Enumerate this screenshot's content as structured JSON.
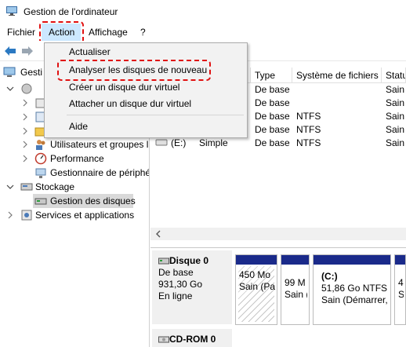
{
  "window": {
    "title": "Gestion de l'ordinateur",
    "icon": "computer-management-icon"
  },
  "menubar": {
    "items": [
      {
        "label": "Fichier"
      },
      {
        "label": "Action"
      },
      {
        "label": "Affichage"
      },
      {
        "label": "?"
      }
    ]
  },
  "action_menu": {
    "items": [
      {
        "label": "Actualiser"
      },
      {
        "label": "Analyser les disques de nouveau"
      },
      {
        "label": "Créer un disque dur virtuel"
      },
      {
        "label": "Attacher un disque dur virtuel"
      },
      {
        "label": "Aide"
      }
    ]
  },
  "tree": {
    "root": "Gestion de l'ordinateur (local)",
    "root_visible": "Gesti",
    "items": [
      {
        "label": "Utilisateurs et groupes l"
      },
      {
        "label": "Performance"
      },
      {
        "label": "Gestionnaire de périphé"
      },
      {
        "label": "Stockage"
      },
      {
        "label": "Gestion des disques"
      },
      {
        "label": "Services et applications"
      }
    ]
  },
  "list": {
    "columns": [
      "Type",
      "Système de fichiers",
      "Statu"
    ],
    "rows": [
      {
        "volume": "",
        "layout": "",
        "type": "De base",
        "fs": "",
        "status": "Sain ("
      },
      {
        "volume": "",
        "layout": "",
        "type": "De base",
        "fs": "",
        "status": "Sain ("
      },
      {
        "volume": "",
        "layout": "",
        "type": "De base",
        "fs": "NTFS",
        "status": "Sain ("
      },
      {
        "volume": "",
        "layout": "",
        "type": "De base",
        "fs": "NTFS",
        "status": "Sain ("
      },
      {
        "volume": "(E:)",
        "layout": "Simple",
        "type": "De base",
        "fs": "NTFS",
        "status": "Sain ("
      }
    ]
  },
  "disks": {
    "disk0": {
      "name": "Disque 0",
      "type": "De base",
      "size": "931,30 Go",
      "status": "En ligne",
      "partitions": [
        {
          "line1": "450 Mo",
          "line2": "Sain (Pa"
        },
        {
          "line1": "99 M",
          "line2": "Sain ("
        },
        {
          "title": "(C:)",
          "line1": "51,86 Go NTFS",
          "line2": "Sain (Démarrer, F"
        },
        {
          "line1": "4",
          "line2": "S"
        }
      ]
    },
    "cdrom": {
      "name": "CD-ROM 0"
    }
  },
  "colors": {
    "partition_bar": "#1a2a8a",
    "highlight": "#e01010",
    "menu_hover": "#cce8ff"
  }
}
